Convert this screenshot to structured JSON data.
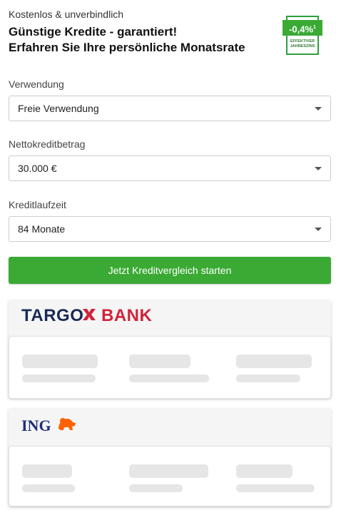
{
  "header": {
    "pretitle": "Kostenlos & unverbindlich",
    "title_line1": "Günstige Kredite - garantiert!",
    "title_line2": "Erfahren Sie Ihre persönliche Monatsrate"
  },
  "badge": {
    "rate": "-0,4%",
    "sup": "1",
    "caption_line1": "EFFEKTIVER",
    "caption_line2": "JAHRESZINS",
    "color": "#3aaa35"
  },
  "form": {
    "usage": {
      "label": "Verwendung",
      "value": "Freie Verwendung"
    },
    "amount": {
      "label": "Nettokreditbetrag",
      "value": "30.000 €"
    },
    "term": {
      "label": "Kreditlaufzeit",
      "value": "84 Monate"
    },
    "submit_label": "Jetzt Kreditvergleich starten"
  },
  "offers": [
    {
      "bank_part1": "TARGO",
      "bank_part2": "BANK",
      "logo_icon": "targo-x-icon"
    },
    {
      "bank": "ING",
      "logo_icon": "ing-lion-icon"
    }
  ],
  "colors": {
    "accent_green": "#3aaa35",
    "targo_navy": "#1a2a55",
    "targo_red": "#d0233a",
    "ing_blue": "#1d2f7a",
    "ing_orange": "#ff6200"
  }
}
